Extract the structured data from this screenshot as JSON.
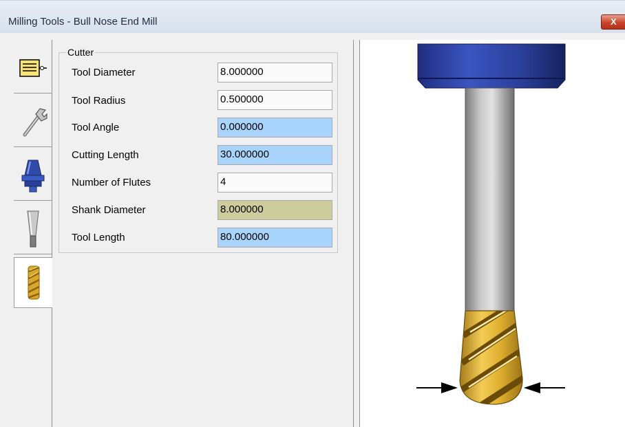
{
  "window": {
    "title": "Milling Tools - Bull Nose End Mill",
    "close_label": "X"
  },
  "tabs": [
    {
      "icon": "parameters-icon"
    },
    {
      "icon": "wrench-icon"
    },
    {
      "icon": "holder-icon"
    },
    {
      "icon": "shank-icon"
    },
    {
      "icon": "cutter-icon"
    }
  ],
  "cutter": {
    "group_label": "Cutter",
    "fields": [
      {
        "label": "Tool Diameter",
        "value": "8.000000"
      },
      {
        "label": "Tool Radius",
        "value": "0.500000"
      },
      {
        "label": "Tool Angle",
        "value": "0.000000"
      },
      {
        "label": "Cutting Length",
        "value": "30.000000"
      },
      {
        "label": "Number of Flutes",
        "value": "4"
      },
      {
        "label": "Shank Diameter",
        "value": "8.000000"
      },
      {
        "label": "Tool Length",
        "value": "80.000000"
      }
    ]
  },
  "colors": {
    "highlight_blue": "#a8d4fb",
    "highlight_olive": "#cccc9c",
    "holder_blue": "#2a3f99",
    "cutter_gold": "#d9a82a",
    "shank_grey": "#9a9a9a"
  }
}
